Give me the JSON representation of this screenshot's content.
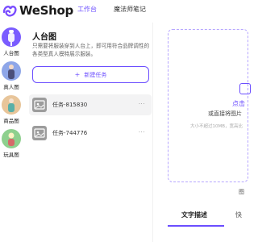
{
  "app": {
    "logo_text": "WeShop",
    "nav": [
      {
        "label": "工作台",
        "active": true
      },
      {
        "label": "魔法师笔记",
        "active": false
      }
    ],
    "accent_color": "#6b4eff"
  },
  "sidebar": {
    "items": [
      {
        "label": "人台图",
        "icon": "mannequin-icon",
        "color": "#7a5cff"
      },
      {
        "label": "真人图",
        "icon": "real-model-icon",
        "color": "#6f8fe0"
      },
      {
        "label": "商品图",
        "icon": "product-icon",
        "color": "#e8b27a"
      },
      {
        "label": "玩具图",
        "icon": "toy-icon",
        "color": "#6fb86f"
      }
    ]
  },
  "panel": {
    "title": "人台图",
    "description": "只需要将服装穿到人台上，即可用符合品牌调性的各类型真人模特展示服装。",
    "new_task_label": "新建任务",
    "tasks": [
      {
        "name": "任务-815830",
        "selected": true
      },
      {
        "name": "任务-744776",
        "selected": false
      }
    ],
    "more_label": "···"
  },
  "upload": {
    "click_text": "点击",
    "drag_text": "或直接将图片",
    "limit_text": "大小不超过10MB，宽高比"
  },
  "right_mark": "图",
  "tabs": [
    {
      "label": "文字描述",
      "active": true
    },
    {
      "label": "快",
      "active": false
    }
  ]
}
